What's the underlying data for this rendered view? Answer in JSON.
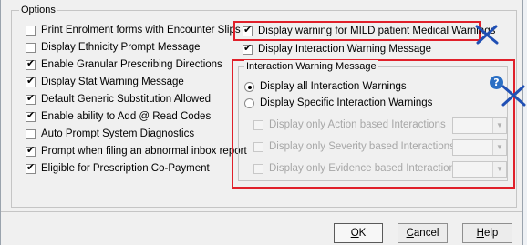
{
  "options": {
    "title": "Options",
    "left_items": [
      {
        "label": "Print Enrolment forms with Encounter Slips",
        "checked": false
      },
      {
        "label": "Display Ethnicity Prompt Message",
        "checked": false
      },
      {
        "label": "Enable Granular Prescribing Directions",
        "checked": true
      },
      {
        "label": "Display Stat Warning Message",
        "checked": true
      },
      {
        "label": "Default Generic Substitution Allowed",
        "checked": true
      },
      {
        "label": "Enable ability to Add @ Read Codes",
        "checked": true
      },
      {
        "label": "Auto Prompt System Diagnostics",
        "checked": false
      },
      {
        "label": "Prompt when filing an abnormal inbox report",
        "checked": true
      },
      {
        "label": "Eligible for Prescription Co-Payment",
        "checked": true
      }
    ],
    "right_items": [
      {
        "label": "Display warning for MILD patient Medical Warnings",
        "checked": true
      },
      {
        "label": "Display Interaction Warning Message",
        "checked": true
      }
    ]
  },
  "interaction_warning": {
    "title": "Interaction Warning Message",
    "radios": [
      {
        "label": "Display all Interaction Warnings",
        "selected": true
      },
      {
        "label": "Display Specific Interaction Warnings",
        "selected": false
      }
    ],
    "filters": [
      {
        "label": "Display only Action based Interactions",
        "checked": false,
        "value": ""
      },
      {
        "label": "Display only Severity based Interactions",
        "checked": false,
        "value": ""
      },
      {
        "label": "Display only Evidence based Interactions",
        "checked": false,
        "value": ""
      }
    ]
  },
  "buttons": {
    "ok": {
      "mnemonic": "O",
      "rest": "K"
    },
    "cancel": {
      "mnemonic": "C",
      "rest": "ancel"
    },
    "help": {
      "mnemonic": "H",
      "rest": "elp"
    }
  },
  "annotation_color": "#e0202a",
  "help_icon_color": "#2b6fc4"
}
